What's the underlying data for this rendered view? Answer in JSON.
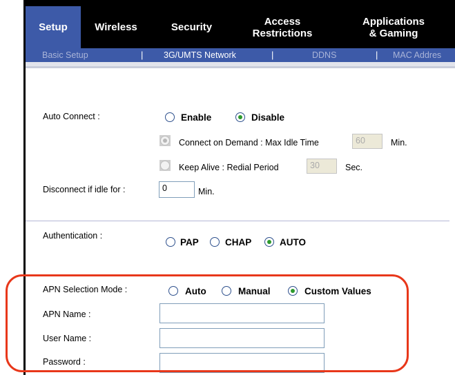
{
  "nav": {
    "tabs": [
      {
        "label": "Setup",
        "active": true
      },
      {
        "label": "Wireless",
        "active": false
      },
      {
        "label": "Security",
        "active": false
      },
      {
        "label": "Access\nRestrictions",
        "active": false
      },
      {
        "label": "Applications\n& Gaming",
        "active": false
      }
    ]
  },
  "subnav": {
    "items": [
      "Basic Setup",
      "3G/UMTS Network",
      "DDNS",
      "MAC Addres"
    ],
    "active": "3G/UMTS Network",
    "separator": "|"
  },
  "form": {
    "auto_connect": {
      "label": "Auto Connect :",
      "enable": "Enable",
      "disable": "Disable",
      "selected": "Disable"
    },
    "connect_on_demand": {
      "label": "Connect on Demand : Max Idle Time",
      "value": "60",
      "unit": "Min."
    },
    "keep_alive": {
      "label": "Keep Alive : Redial Period",
      "value": "30",
      "unit": "Sec."
    },
    "disconnect_idle": {
      "label": "Disconnect if idle for :",
      "value": "0",
      "unit": "Min."
    },
    "authentication": {
      "label": "Authentication :",
      "options": [
        "PAP",
        "CHAP",
        "AUTO"
      ],
      "selected": "AUTO"
    },
    "apn_selection_mode": {
      "label": "APN Selection Mode :",
      "options": [
        "Auto",
        "Manual",
        "Custom Values"
      ],
      "selected": "Custom Values"
    },
    "apn_name": {
      "label": "APN Name :",
      "value": ""
    },
    "user_name": {
      "label": "User Name :",
      "value": ""
    },
    "password": {
      "label": "Password :",
      "value": ""
    }
  },
  "colors": {
    "nav_bg": "#000000",
    "active_tab": "#3d5aa8",
    "highlight_border": "#e8371a",
    "radio_selected": "#2d9a2d"
  }
}
